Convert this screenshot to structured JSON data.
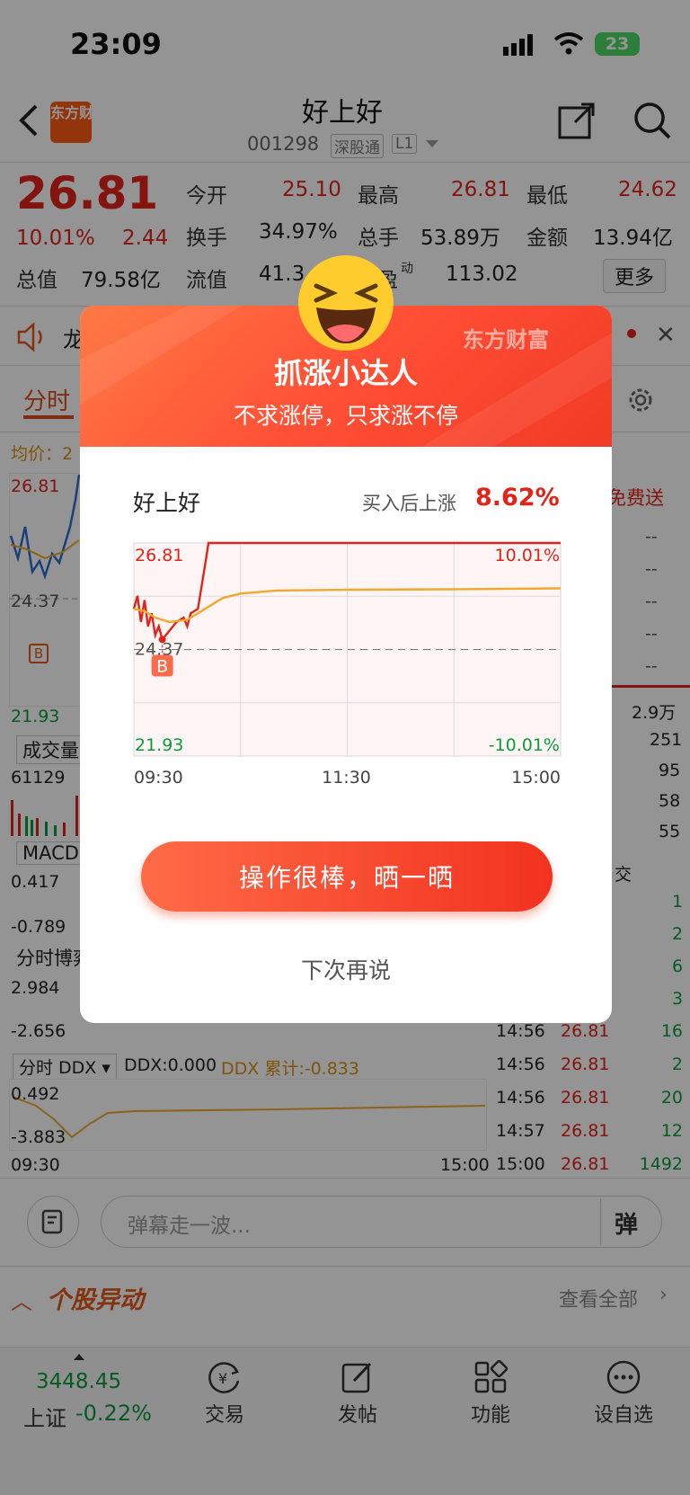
{
  "status_bar": {
    "time": "23:09",
    "battery": "23"
  },
  "nav": {
    "logo": "东方财富",
    "title": "好上好",
    "code": "001298",
    "tag_market": "深股通",
    "tag_level": "L1"
  },
  "quote": {
    "price": "26.81",
    "change_pct": "10.01%",
    "change": "2.44",
    "open_label": "今开",
    "open": "25.10",
    "high_label": "最高",
    "high": "26.81",
    "low_label": "最低",
    "low": "24.62",
    "turnover_label": "换手",
    "turnover": "34.97%",
    "volume_label": "总手",
    "volume": "53.89万",
    "amount_label": "金额",
    "amount": "13.94亿",
    "mktcap_label": "总值",
    "mktcap": "79.58亿",
    "float_label": "流值",
    "float": "41.3",
    "pe_label": "盈",
    "pe_sup": "动",
    "pe": "113.02",
    "more": "更多"
  },
  "background": {
    "notice_char": "龙",
    "tab_active": "分时",
    "avg_label": "均价：2",
    "left_top": "26.81",
    "left_mid": "24.37",
    "left_low": "21.93",
    "b_marker": "B",
    "vol_label": "成交量",
    "vol_val": "61129",
    "macd_label": "MACD",
    "macd_hi": "0.417",
    "macd_lo": "-0.789",
    "game_label": "分时博弈",
    "game_hi": "2.984",
    "game_lo": "-2.656",
    "ddx_select": "分时 DDX",
    "ddx_val": "DDX:0.000",
    "ddx_cum": "DDX 累计:-0.833",
    "ddx_hi": "0.492",
    "ddx_lo": "-3.883",
    "time_start": "09:30",
    "time_end": "15:00",
    "right_free": "免费送",
    "right_vols": [
      "2.9万",
      "251",
      "95",
      "58",
      "55"
    ],
    "right_deal_label": "交",
    "right_counts": [
      "1",
      "2",
      "6",
      "3"
    ],
    "trades": [
      {
        "time": "14:56",
        "price": "26.81",
        "vol": "16"
      },
      {
        "time": "14:56",
        "price": "26.81",
        "vol": "2"
      },
      {
        "time": "14:56",
        "price": "26.81",
        "vol": "20"
      },
      {
        "time": "14:57",
        "price": "26.81",
        "vol": "12"
      },
      {
        "time": "15:00",
        "price": "26.81",
        "vol": "1492"
      }
    ],
    "danmu_placeholder": "弹幕走一波...",
    "danmu_btn": "弹",
    "section_title": "个股异动",
    "section_more": "查看全部"
  },
  "bottom_bar": {
    "index_value": "3448.45",
    "index_name": "上证",
    "index_change": "-0.22%",
    "tabs": [
      {
        "label": "交易",
        "icon": "yen-cycle-icon"
      },
      {
        "label": "发帖",
        "icon": "edit-icon"
      },
      {
        "label": "功能",
        "icon": "grid-icon"
      },
      {
        "label": "设自选",
        "icon": "more-circle-icon"
      }
    ]
  },
  "modal": {
    "brand": "东方财富",
    "title": "抓涨小达人",
    "subtitle": "不求涨停，只求涨不停",
    "stock_name": "好上好",
    "rise_label": "买入后上涨",
    "rise_value": "8.62%",
    "chart_data": {
      "type": "line",
      "x": [
        "09:30",
        "11:30",
        "15:00"
      ],
      "y_left_labels": [
        "26.81",
        "24.37",
        "21.93"
      ],
      "y_right_labels": [
        "10.01%",
        "-10.01%"
      ],
      "buy_marker": "B",
      "ylim": [
        21.93,
        26.81
      ],
      "series": [
        {
          "color": "#e2231a",
          "points": [
            [
              0,
              25.3
            ],
            [
              2,
              25.6
            ],
            [
              4,
              25.0
            ],
            [
              6,
              25.5
            ],
            [
              8,
              24.9
            ],
            [
              10,
              25.2
            ],
            [
              12,
              24.7
            ],
            [
              14,
              24.9
            ],
            [
              16,
              24.6
            ],
            [
              20,
              24.8
            ],
            [
              24,
              25.0
            ],
            [
              28,
              25.1
            ],
            [
              30,
              24.9
            ],
            [
              32,
              25.2
            ],
            [
              36,
              25.3
            ],
            [
              40,
              26.3
            ],
            [
              42,
              26.81
            ],
            [
              240,
              26.81
            ]
          ]
        },
        {
          "color": "#f0a830",
          "points": [
            [
              0,
              25.3
            ],
            [
              6,
              25.25
            ],
            [
              12,
              25.1
            ],
            [
              20,
              25.0
            ],
            [
              30,
              25.05
            ],
            [
              40,
              25.3
            ],
            [
              50,
              25.55
            ],
            [
              60,
              25.65
            ],
            [
              80,
              25.72
            ],
            [
              120,
              25.74
            ],
            [
              180,
              25.75
            ],
            [
              240,
              25.77
            ]
          ]
        }
      ]
    },
    "primary_btn": "操作很棒，晒一晒",
    "secondary_btn": "下次再说"
  }
}
